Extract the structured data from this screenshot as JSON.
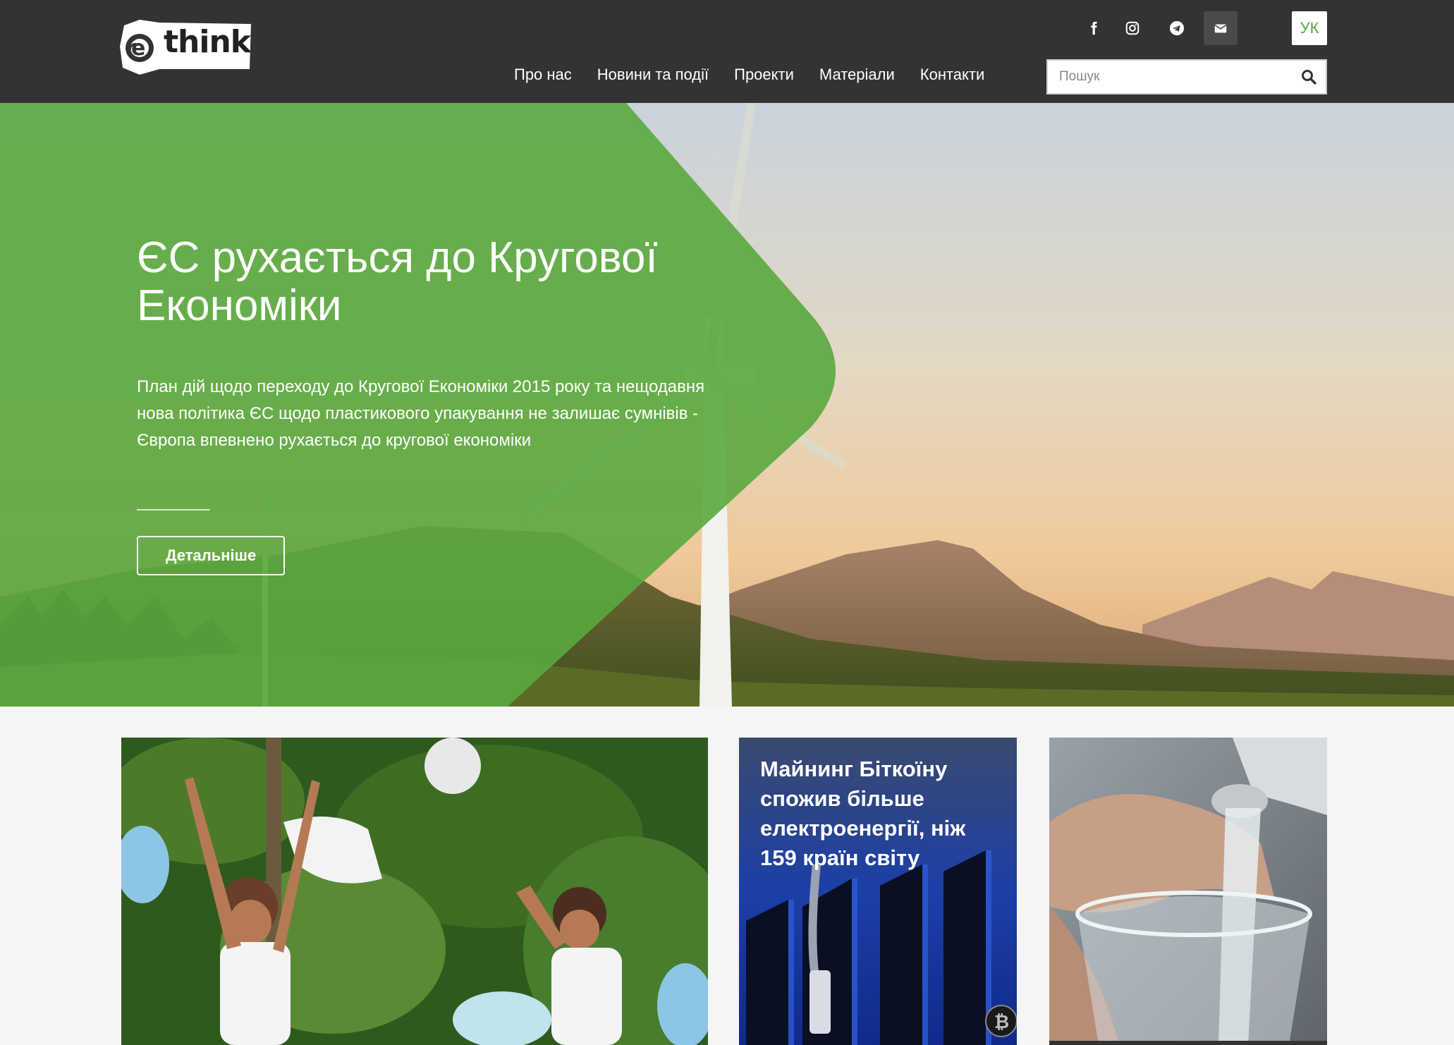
{
  "header": {
    "logo_text": "think",
    "lang_label": "УК",
    "nav": [
      {
        "label": "Про нас"
      },
      {
        "label": "Новини та події"
      },
      {
        "label": "Проекти"
      },
      {
        "label": "Матеріали"
      },
      {
        "label": "Контакти"
      }
    ],
    "social_icons": [
      "facebook-icon",
      "instagram-icon",
      "telegram-icon",
      "mail-icon"
    ],
    "search": {
      "placeholder": "Пошук",
      "value": ""
    }
  },
  "hero": {
    "title": "ЄС рухається до Кругової Економіки",
    "description": "План дій щодо переходу до Кругової Економіки 2015 року та нещодавня нова політика ЄС щодо пластикового упакування не залишає сумнівів - Європа впевнено рухається до кругової економіки",
    "button_label": "Детальніше",
    "accent_color": "#5aa83e"
  },
  "cards": [
    {
      "title": ""
    },
    {
      "title": "Майнинг Біткоїну спожив більше електроенергії, ніж 159 країн світу"
    },
    {
      "title": ""
    }
  ]
}
